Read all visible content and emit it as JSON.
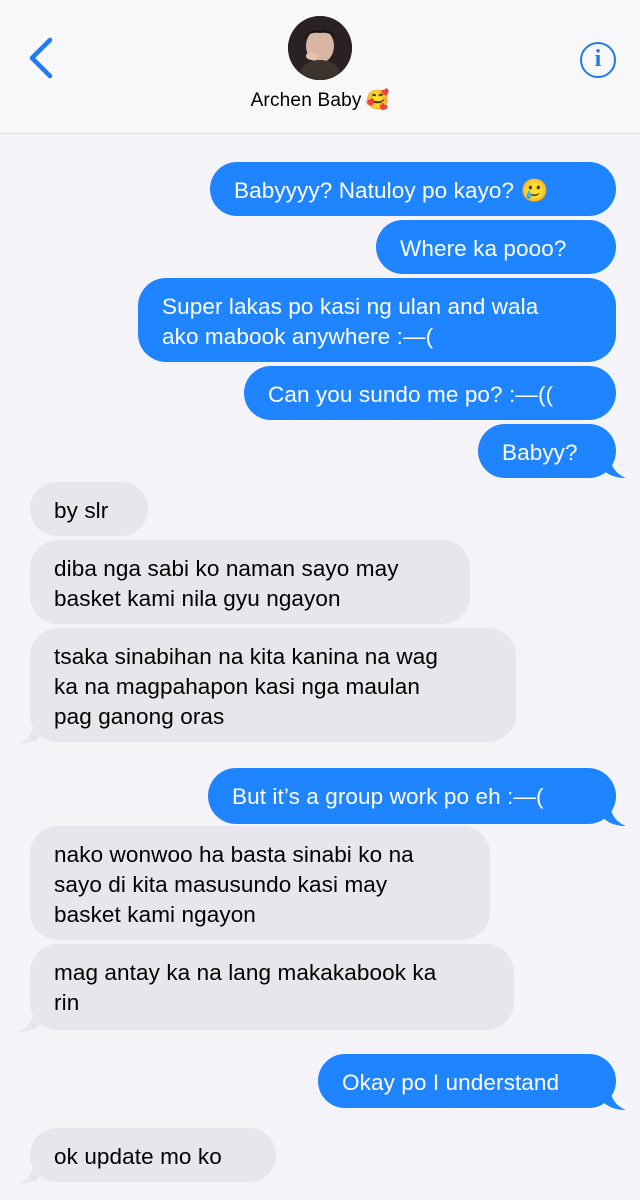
{
  "header": {
    "contact_name": "Archen Baby",
    "name_emoji": "🥰",
    "info_glyph": "i",
    "accent_color": "#1f7bf2"
  },
  "colors": {
    "sent_bubble": "#1f84ff",
    "received_bubble": "#e7e6ec",
    "background": "#f4f3f8"
  },
  "messages": [
    {
      "from": "me",
      "text": "Babyyyy? Natuloy po kayo? 🥲"
    },
    {
      "from": "me",
      "text": "Where ka pooo?"
    },
    {
      "from": "me",
      "text": "Super lakas po kasi ng ulan and wala\nako mabook anywhere :—("
    },
    {
      "from": "me",
      "text": "Can you sundo me po? :—(("
    },
    {
      "from": "me",
      "text": "Babyy?"
    },
    {
      "from": "them",
      "text": "by slr"
    },
    {
      "from": "them",
      "text": "diba nga sabi ko naman sayo may\nbasket kami nila gyu ngayon"
    },
    {
      "from": "them",
      "text": "tsaka sinabihan na kita kanina na wag\nka na magpahapon kasi nga maulan\npag ganong oras"
    },
    {
      "from": "me",
      "text": "But it’s a group work po eh :—("
    },
    {
      "from": "them",
      "text": "nako wonwoo ha basta sinabi ko na\nsayo di kita masusundo kasi may\nbasket kami ngayon"
    },
    {
      "from": "them",
      "text": "mag antay ka na lang makakabook ka\nrin"
    },
    {
      "from": "me",
      "text": "Okay po I understand"
    },
    {
      "from": "them",
      "text": "ok update mo ko"
    }
  ]
}
